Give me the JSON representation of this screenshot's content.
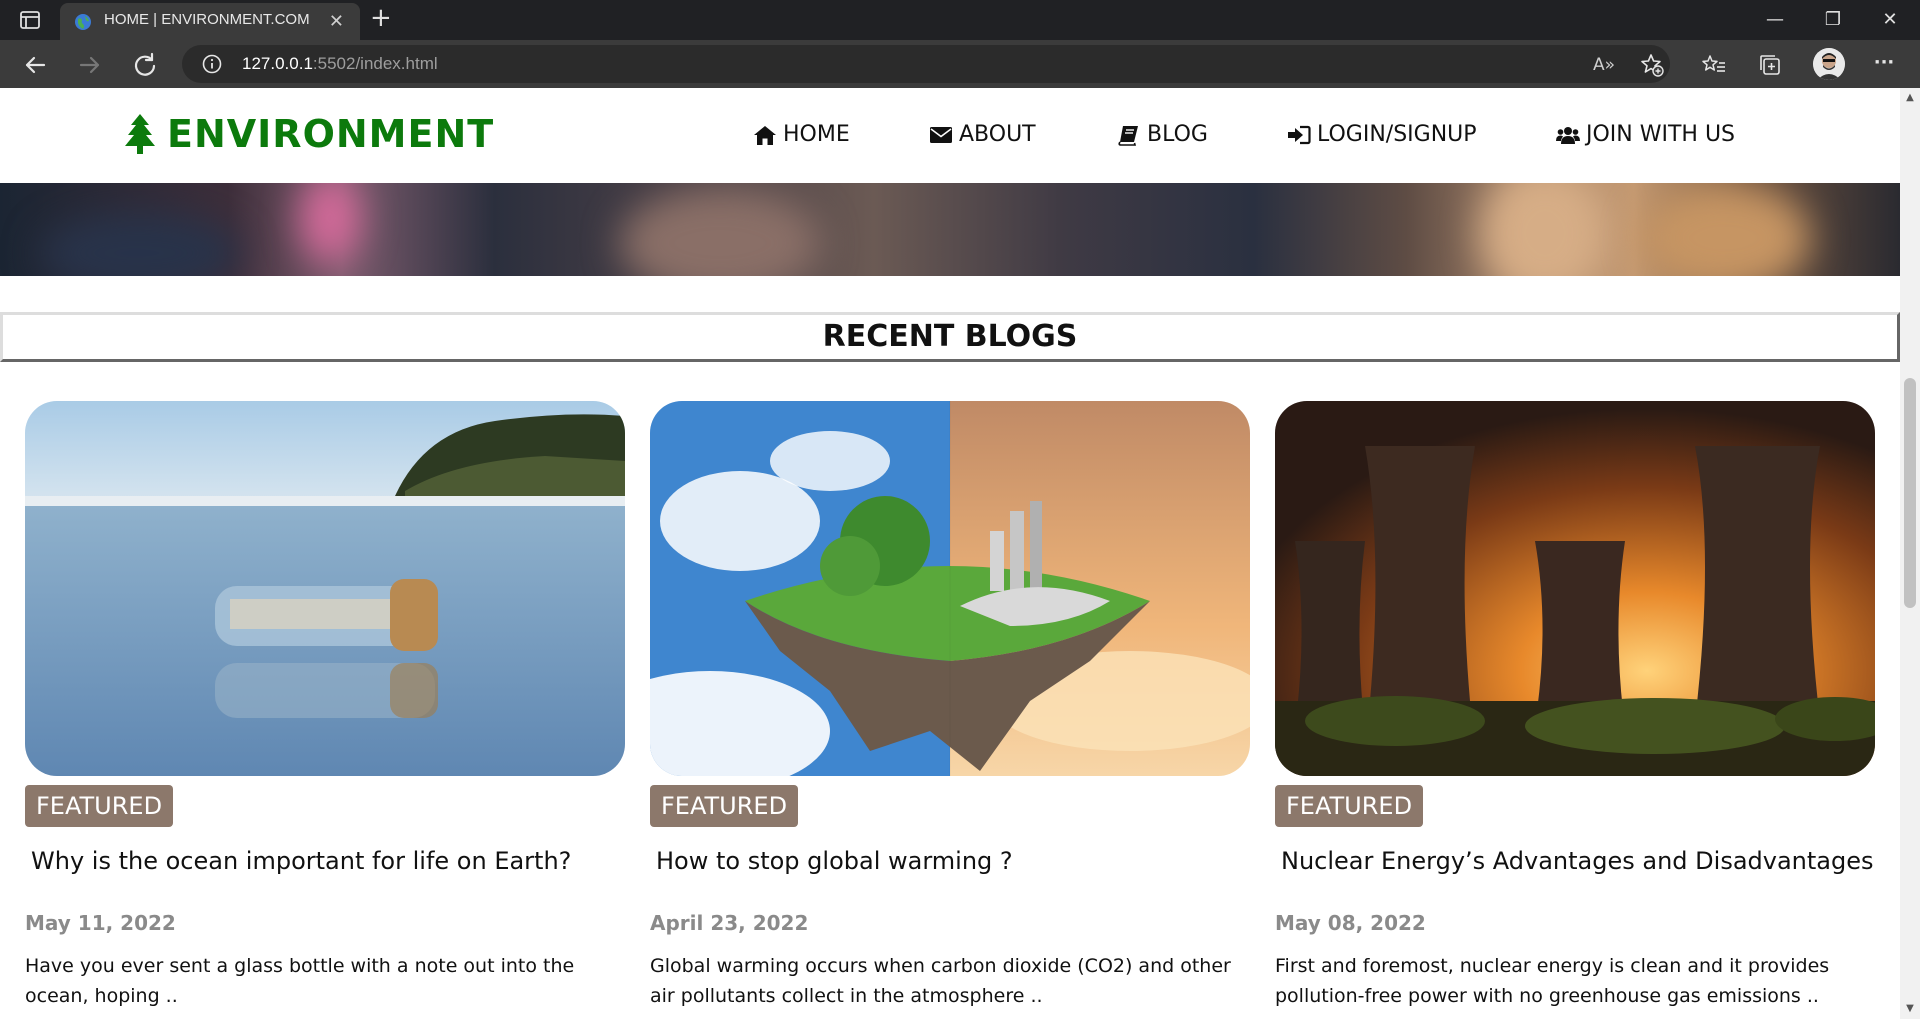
{
  "browser": {
    "tab_title": "HOME | ENVIRONMENT.COM",
    "url_host": "127.0.0.1",
    "url_rest": ":5502/index.html",
    "read_aloud_label": "A»"
  },
  "site": {
    "brand": "ENVIRONMENT",
    "brand_color": "#0c7a0c",
    "nav": [
      {
        "label": "HOME",
        "icon": "home-icon"
      },
      {
        "label": "ABOUT",
        "icon": "envelope-icon"
      },
      {
        "label": "BLOG",
        "icon": "book-icon"
      },
      {
        "label": "LOGIN/SIGNUP",
        "icon": "sign-in-icon"
      },
      {
        "label": "JOIN WITH US",
        "icon": "users-icon"
      }
    ]
  },
  "section_title": "RECENT BLOGS",
  "posts": [
    {
      "badge": "FEATURED",
      "title": "Why is the ocean important for life on Earth?",
      "date": "May 11, 2022",
      "excerpt": "Have you ever sent a glass bottle with a note out into the ocean, hoping .."
    },
    {
      "badge": "FEATURED",
      "title": "How to stop global warming ?",
      "date": "April 23, 2022",
      "excerpt": "Global warming occurs when carbon dioxide (CO2) and other air pollutants collect in the atmosphere .."
    },
    {
      "badge": "FEATURED",
      "title": "Nuclear Energy’s Advantages and Disadvantages",
      "date": "May 08, 2022",
      "excerpt": "First and foremost, nuclear energy is clean and it provides pollution-free power with no greenhouse gas emissions .."
    }
  ],
  "colors": {
    "badge_bg": "#8c786b",
    "date_text": "#8a8a8a"
  }
}
